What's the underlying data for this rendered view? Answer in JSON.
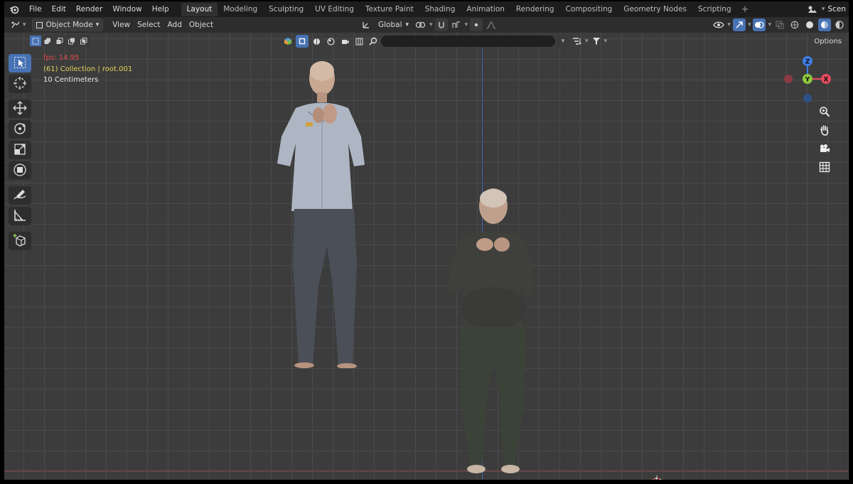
{
  "topbar": {
    "menus": [
      "File",
      "Edit",
      "Render",
      "Window",
      "Help"
    ],
    "workspaces": [
      "Layout",
      "Modeling",
      "Sculpting",
      "UV Editing",
      "Texture Paint",
      "Shading",
      "Animation",
      "Rendering",
      "Compositing",
      "Geometry Nodes",
      "Scripting"
    ],
    "active_workspace": "Layout",
    "add_workspace": "+",
    "scene_label": "Scen"
  },
  "header": {
    "mode": "Object Mode",
    "menus": [
      "View",
      "Select",
      "Add",
      "Object"
    ],
    "transform_orientation": "Global",
    "options_label": "Options"
  },
  "overlay": {
    "fps": "fps: 14.95",
    "collection": "(61) Collection | root.001",
    "units": "10 Centimeters"
  },
  "gizmo": {
    "z": "Z",
    "y": "Y",
    "x": "X"
  },
  "colors": {
    "accent": "#4772b3",
    "x_axis": "#e34b5e",
    "y_axis": "#8cc83a",
    "z_axis": "#3f7ee6",
    "fps": "#e34b4b",
    "collection": "#e2d45c"
  },
  "icons": {
    "logo": "blender-logo-icon",
    "tools": [
      "select-box-icon",
      "cursor-icon",
      "move-icon",
      "rotate-icon",
      "scale-icon",
      "transform-icon",
      "annotate-icon",
      "measure-icon",
      "add-cube-icon"
    ],
    "nav": [
      "zoom-icon",
      "hand-pan-icon",
      "camera-icon",
      "grid-ortho-icon"
    ]
  }
}
